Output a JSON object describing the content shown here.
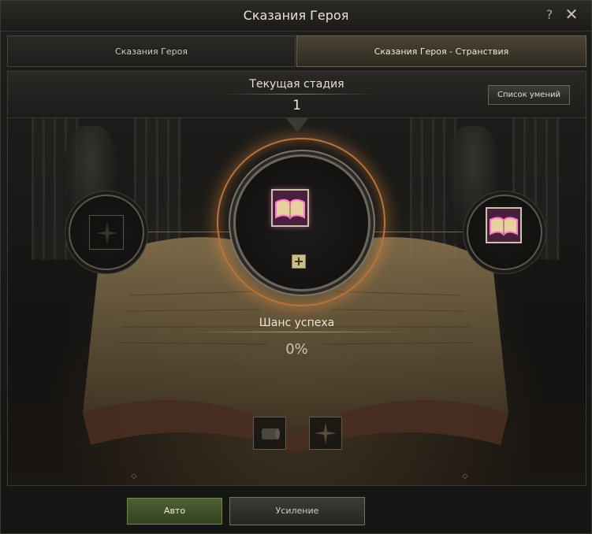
{
  "window": {
    "title": "Сказания Героя",
    "help_glyph": "?",
    "close_glyph": "✕"
  },
  "tabs": [
    {
      "label": "Сказания Героя",
      "active": false
    },
    {
      "label": "Сказания Героя - Странствия",
      "active": true
    }
  ],
  "stage": {
    "label": "Текущая стадия",
    "value": "1"
  },
  "skill_list_button": "Список умений",
  "success": {
    "label": "Шанс успеха",
    "value": "0%"
  },
  "plus_glyph": "+",
  "buttons": {
    "auto": "Авто",
    "enhance": "Усиление"
  },
  "icons": {
    "left_node": "compass-star-icon",
    "center_item": "pink-book-icon",
    "right_item": "pink-book-icon",
    "bottom_left": "scroll-icon",
    "bottom_right": "compass-star-icon"
  },
  "colors": {
    "auto_button": "#4e5f36",
    "ring_glow": "#b8743c",
    "item_glow": "#ff78c8"
  }
}
